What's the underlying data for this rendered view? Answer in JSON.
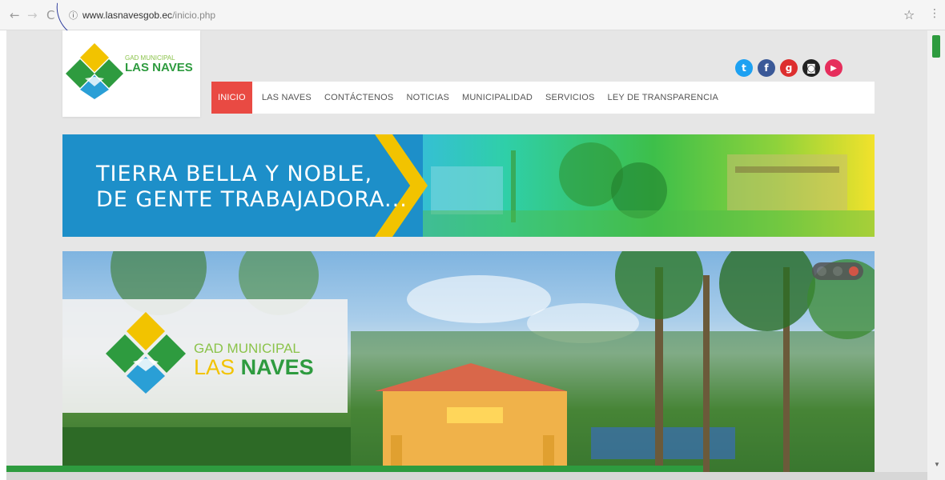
{
  "browser": {
    "back_icon": "back-arrow-icon",
    "forward_icon": "forward-arrow-icon",
    "reload_icon": "reload-icon",
    "url_host": "www.lasnavesgob.ec",
    "url_path": "/inicio.php",
    "bookmark_icon": "star-icon",
    "menu_icon": "three-dots-icon"
  },
  "header": {
    "logo_text_top": "GAD MUNICIPAL",
    "logo_text_bottom": "LAS NAVES",
    "socials": [
      {
        "name": "twitter",
        "glyph": "t",
        "color": "#1da1f2"
      },
      {
        "name": "facebook",
        "glyph": "f",
        "color": "#3b5998"
      },
      {
        "name": "google-plus",
        "glyph": "g",
        "color": "#dd2e2e"
      },
      {
        "name": "instagram",
        "glyph": "◙",
        "color": "#222222"
      },
      {
        "name": "youtube",
        "glyph": "▶",
        "color": "#e62e5c"
      }
    ],
    "nav": [
      "INICIO",
      "LAS NAVES",
      "CONTÁCTENOS",
      "NOTICIAS",
      "MUNICIPALIDAD",
      "SERVICIOS",
      "LEY DE TRANSPARENCIA"
    ]
  },
  "banner": {
    "line1": "TIERRA BELLA Y NOBLE,",
    "line2": "DE GENTE TRABAJADORA..."
  },
  "hero": {
    "logo_text_top": "GAD MUNICIPAL",
    "logo_text_bottom_1": "LAS",
    "logo_text_bottom_2": "NAVES"
  },
  "colors": {
    "accent_red": "#e94a43",
    "brand_green": "#2e9b3f",
    "brand_yellow": "#f2c300",
    "brand_blue": "#1d8fc9"
  }
}
